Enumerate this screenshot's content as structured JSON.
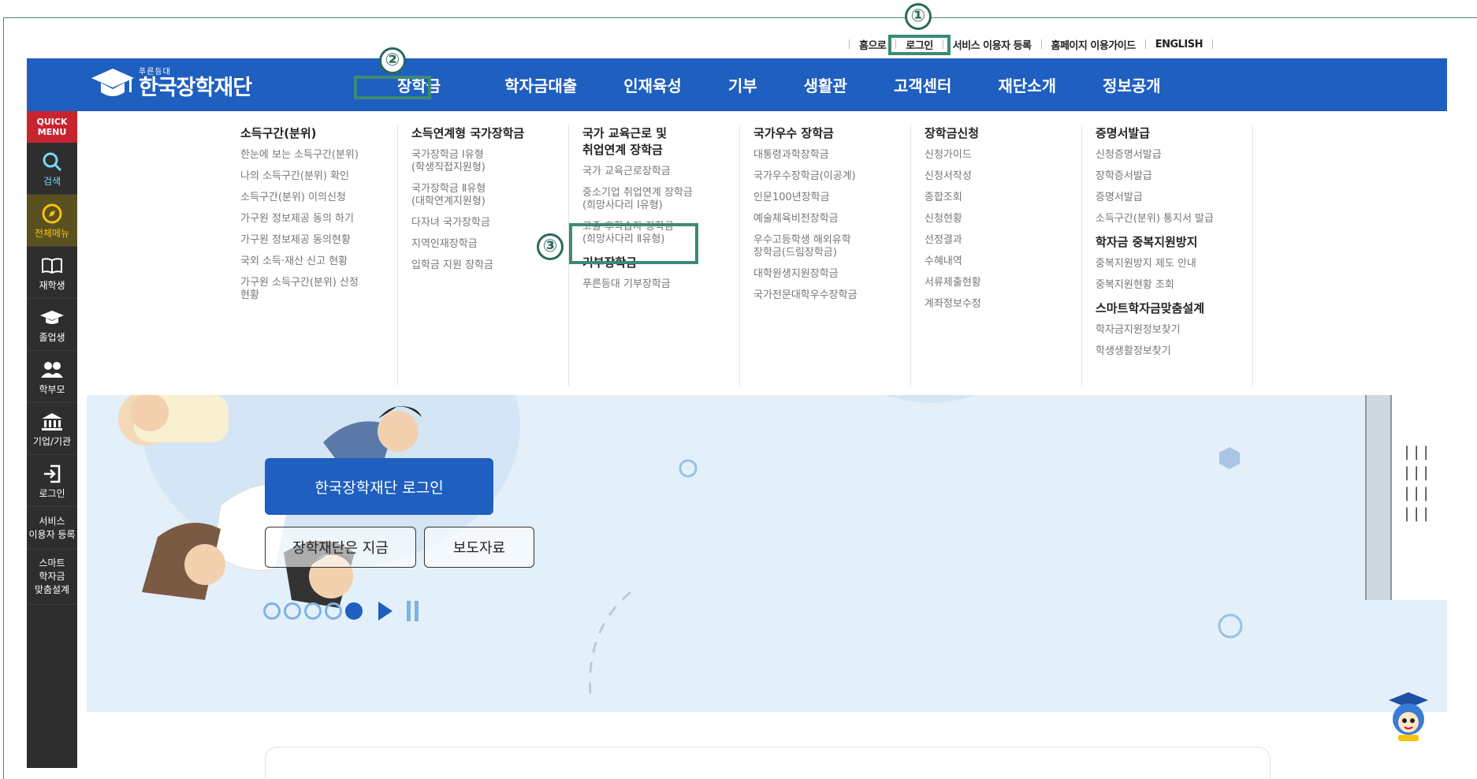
{
  "util_links": [
    "홈으로",
    "로그인",
    "서비스 이용자 등록",
    "홈페이지 이용가이드",
    "ENGLISH"
  ],
  "callouts": [
    "①",
    "②",
    "③"
  ],
  "logo": {
    "small": "푸른등대",
    "big": "한국장학재단"
  },
  "nav": [
    "장학금",
    "학자금대출",
    "인재육성",
    "기부",
    "생활관",
    "고객센터",
    "재단소개",
    "정보공개"
  ],
  "quick_menu": {
    "title": "QUICK\nMENU",
    "items": [
      {
        "label": "검색",
        "icon": "search-icon"
      },
      {
        "label": "전체메뉴",
        "icon": "compass-icon"
      },
      {
        "label": "재학생",
        "icon": "book-icon"
      },
      {
        "label": "졸업생",
        "icon": "graduation-cap-icon"
      },
      {
        "label": "학부모",
        "icon": "people-icon"
      },
      {
        "label": "기업/기관",
        "icon": "institution-icon"
      },
      {
        "label": "로그인",
        "icon": "login-icon"
      }
    ],
    "service_register": "서비스\n이용자 등록",
    "smart_design": "스마트\n학자금\n맞춤설계"
  },
  "mega_menu": [
    {
      "heading": "소득구간(분위)",
      "links": [
        "한눈에 보는 소득구간(분위)",
        "나의 소득구간(분위) 확인",
        "소득구간(분위) 이의신청",
        "가구원 정보제공 동의 하기",
        "가구원 정보제공 동의현황",
        "국외 소득·재산 신고 현황",
        "가구원 소득구간(분위) 산정\n현황"
      ]
    },
    {
      "heading": "소득연계형 국가장학금",
      "links": [
        "국가장학금 Ⅰ유형\n(학생직접지원형)",
        "국가장학금 Ⅱ유형\n(대학연계지원형)",
        "다자녀 국가장학금",
        "지역인재장학금",
        "입학금 지원 장학금"
      ]
    },
    {
      "heading": "국가 교육근로 및\n취업연계 장학금",
      "links": [
        "국가 교육근로장학금",
        "중소기업 취업연계 장학금\n(희망사다리 Ⅰ유형)",
        "고졸 후학습자 장학금\n(희망사다리 Ⅱ유형)"
      ],
      "heading2": "기부장학금",
      "links2": [
        "푸른등대 기부장학금"
      ]
    },
    {
      "heading": "국가우수 장학금",
      "links": [
        "대통령과학장학금",
        "국가우수장학금(이공계)",
        "인문100년장학금",
        "예술체육비전장학금",
        "우수고등학생 해외유학\n장학금(드림장학금)",
        "대학원생지원장학금",
        "국가전문대학우수장학금"
      ]
    },
    {
      "heading": "장학금신청",
      "links": [
        "신청가이드",
        "신청서작성",
        "종합조회",
        "신청현황",
        "선정결과",
        "수혜내역",
        "서류제출현황",
        "계좌정보수정"
      ]
    },
    {
      "heading": "증명서발급",
      "links": [
        "신청증명서발급",
        "장학증서발급",
        "증명서발급",
        "소득구간(분위) 통지서 발급"
      ],
      "heading2": "학자금 중복지원방지",
      "links2": [
        "중복지원방지 제도 안내",
        "중복지원현황 조회"
      ],
      "heading3": "스마트학자금맞춤설계",
      "links3": [
        "학자금지원정보찾기",
        "학생생활정보찾기"
      ]
    }
  ],
  "hero": {
    "login_button": "한국장학재단 로그인",
    "btn_now": "장학재단은 지금",
    "btn_press": "보도자료"
  },
  "colors": {
    "brand_blue": "#1e5fbf",
    "callout_green": "#3d8a76",
    "quick_red": "#c8242f"
  }
}
